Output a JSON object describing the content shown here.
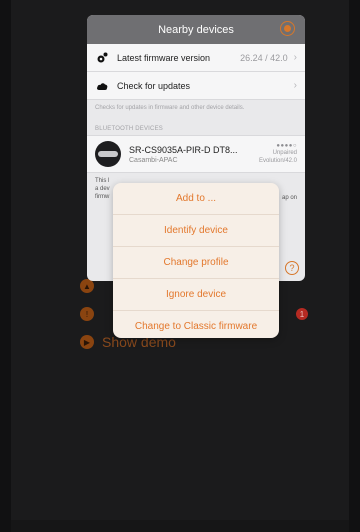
{
  "panel": {
    "title": "Nearby devices",
    "rows": [
      {
        "label": "Latest firmware version",
        "value": "26.24 / 42.0",
        "icon": "gear-icon"
      },
      {
        "label": "Check for updates",
        "value": "",
        "icon": "cloud-icon"
      }
    ],
    "note": "Checks for updates in firmware and other device details.",
    "section_title": "BLUETOOTH DEVICES",
    "device": {
      "name": "SR-CS9035A-PIR-D DT8...",
      "sub": "Casambi-APAC",
      "signal": "●●●●○",
      "status_line1": "Unpaired",
      "status_line2": "Evolution/42.0"
    },
    "footer_text_line1": "This l",
    "footer_text_line2": "a dev",
    "footer_text_line3": "firmw",
    "footer_right": "ap on",
    "help_glyph": "?"
  },
  "background_menu": {
    "items": [
      {
        "label": "",
        "icon": "settings-icon"
      },
      {
        "label": "",
        "icon": "alert-icon"
      },
      {
        "label": "Show demo",
        "icon": "play-icon"
      }
    ],
    "badge": "1"
  },
  "action_sheet": {
    "items": [
      "Add to ...",
      "Identify device",
      "Change profile",
      "Ignore device",
      "Change to Classic firmware"
    ]
  },
  "colors": {
    "accent": "#e3782d",
    "header": "#6f6f72"
  }
}
